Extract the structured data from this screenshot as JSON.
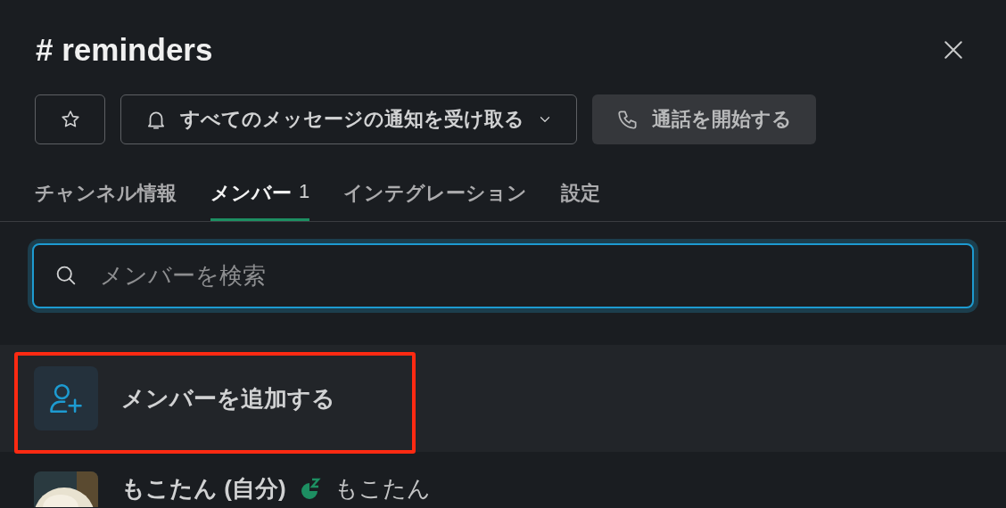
{
  "channel": {
    "title": "# reminders"
  },
  "actions": [
    {
      "kind": "star"
    },
    {
      "kind": "notify",
      "label": "すべてのメッセージの通知を受け取る"
    },
    {
      "kind": "call",
      "label": "通話を開始する"
    }
  ],
  "tabs": [
    {
      "label": "チャンネル情報",
      "selected": false
    },
    {
      "label": "メンバー",
      "count": "1",
      "selected": true
    },
    {
      "label": "インテグレーション",
      "selected": false
    },
    {
      "label": "設定",
      "selected": false
    }
  ],
  "search": {
    "placeholder": "メンバーを検索"
  },
  "add_member": {
    "label": "メンバーを追加する",
    "highlighted": true
  },
  "members": [
    {
      "name": "もこたん (自分)",
      "snoozed": true,
      "display_name": "もこたん"
    }
  ]
}
